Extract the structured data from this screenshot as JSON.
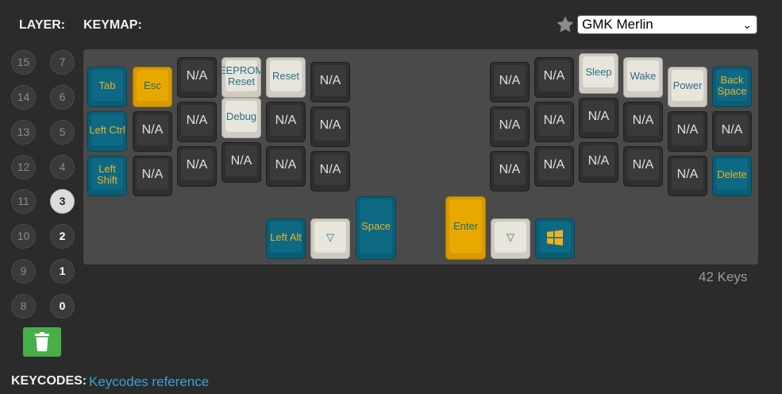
{
  "header": {
    "layer_label": "LAYER:",
    "keymap_label": "KEYMAP:",
    "theme_value": "GMK Merlin"
  },
  "layers": [
    {
      "label": "15",
      "state": "empty"
    },
    {
      "label": "7",
      "state": "empty"
    },
    {
      "label": "14",
      "state": "empty"
    },
    {
      "label": "6",
      "state": "empty"
    },
    {
      "label": "13",
      "state": "empty"
    },
    {
      "label": "5",
      "state": "empty"
    },
    {
      "label": "12",
      "state": "empty"
    },
    {
      "label": "4",
      "state": "empty"
    },
    {
      "label": "11",
      "state": "empty"
    },
    {
      "label": "3",
      "state": "active"
    },
    {
      "label": "10",
      "state": "empty"
    },
    {
      "label": "2",
      "state": "used"
    },
    {
      "label": "9",
      "state": "empty"
    },
    {
      "label": "1",
      "state": "used"
    },
    {
      "label": "8",
      "state": "empty"
    },
    {
      "label": "0",
      "state": "used"
    }
  ],
  "keys": [
    {
      "label": "Tab",
      "color": "blue"
    },
    {
      "label": "Esc",
      "color": "orange"
    },
    {
      "label": "N/A",
      "color": "dark"
    },
    {
      "label": "EEPROM Reset",
      "color": "cream"
    },
    {
      "label": "Reset",
      "color": "cream"
    },
    {
      "label": "N/A",
      "color": "dark"
    },
    {
      "label": "N/A",
      "color": "dark"
    },
    {
      "label": "N/A",
      "color": "dark"
    },
    {
      "label": "Sleep",
      "color": "cream"
    },
    {
      "label": "Wake",
      "color": "cream"
    },
    {
      "label": "Power",
      "color": "cream"
    },
    {
      "label": "Back Space",
      "color": "blue"
    },
    {
      "label": "Left Ctrl",
      "color": "blue"
    },
    {
      "label": "N/A",
      "color": "dark"
    },
    {
      "label": "N/A",
      "color": "dark"
    },
    {
      "label": "Debug",
      "color": "cream"
    },
    {
      "label": "N/A",
      "color": "dark"
    },
    {
      "label": "N/A",
      "color": "dark"
    },
    {
      "label": "N/A",
      "color": "dark"
    },
    {
      "label": "N/A",
      "color": "dark"
    },
    {
      "label": "N/A",
      "color": "dark"
    },
    {
      "label": "N/A",
      "color": "dark"
    },
    {
      "label": "N/A",
      "color": "dark"
    },
    {
      "label": "N/A",
      "color": "dark"
    },
    {
      "label": "Left Shift",
      "color": "blue"
    },
    {
      "label": "N/A",
      "color": "dark"
    },
    {
      "label": "N/A",
      "color": "dark"
    },
    {
      "label": "N/A",
      "color": "dark"
    },
    {
      "label": "N/A",
      "color": "dark"
    },
    {
      "label": "N/A",
      "color": "dark"
    },
    {
      "label": "N/A",
      "color": "dark"
    },
    {
      "label": "N/A",
      "color": "dark"
    },
    {
      "label": "N/A",
      "color": "dark"
    },
    {
      "label": "N/A",
      "color": "dark"
    },
    {
      "label": "N/A",
      "color": "dark"
    },
    {
      "label": "Delete",
      "color": "blue"
    },
    {
      "label": "Left Alt",
      "color": "blue"
    },
    {
      "label": "▽",
      "color": "cream"
    },
    {
      "label": "Space",
      "color": "blue"
    },
    {
      "label": "Enter",
      "color": "orange"
    },
    {
      "label": "▽",
      "color": "cream"
    },
    {
      "label": "",
      "color": "blue",
      "icon": "windows-icon"
    }
  ],
  "keys_count": "42 Keys",
  "footer": {
    "keycodes_label": "KEYCODES:",
    "keycodes_link": "Keycodes reference"
  },
  "colors": {
    "background": "#2b2b2b",
    "board": "#4a4a4a",
    "key_blue": "#0e6a84",
    "key_orange": "#e8a800",
    "key_cream": "#e8e5dd",
    "key_dark": "#3a3a3a",
    "trash_button": "#48ae4a",
    "link": "#3aa1d8"
  }
}
